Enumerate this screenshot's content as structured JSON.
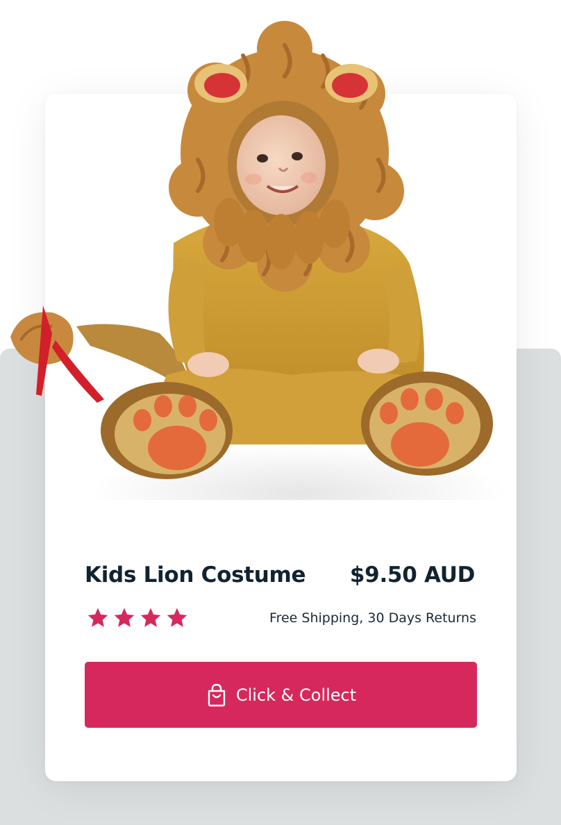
{
  "product": {
    "image_alt": "Child wearing a plush lion costume",
    "title": "Kids Lion Costume",
    "price": "$9.50 AUD",
    "rating": 4,
    "rating_max": 4,
    "shipping_note": "Free Shipping, 30 Days Returns"
  },
  "cta": {
    "label": "Click & Collect",
    "icon": "shopping-bag-icon"
  },
  "colors": {
    "accent": "#d6285c",
    "text_dark": "#112330",
    "backdrop": "#dcdfe0",
    "card": "#ffffff"
  }
}
